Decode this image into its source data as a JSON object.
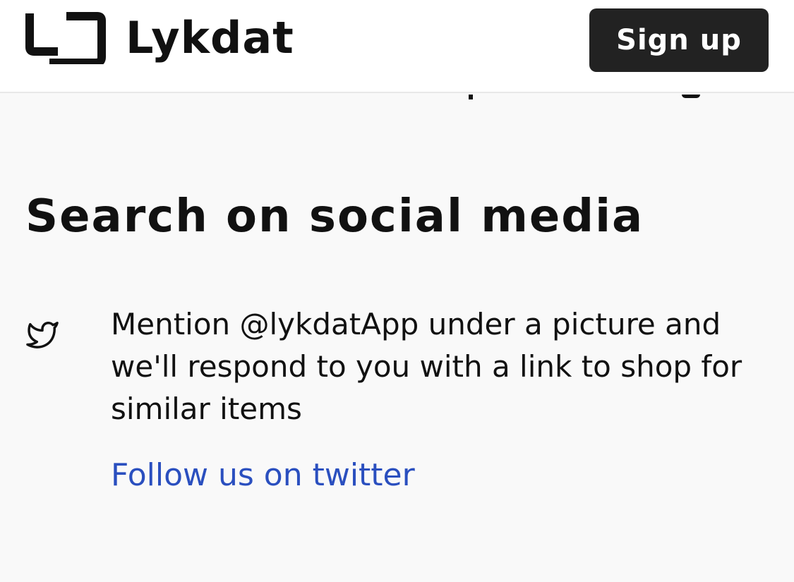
{
  "header": {
    "brand_name": "Lykdat",
    "logo_icon": "lykdat-logo-icon",
    "signup_label": "Sign up"
  },
  "social": {
    "title": "Search on social media",
    "twitter": {
      "icon": "twitter-bird-icon",
      "description": "Mention @lykdatApp under a picture and we'll respond to you with a link to shop for similar items",
      "link_label": "Follow us on twitter"
    }
  },
  "colors": {
    "background": "#f9f9f9",
    "header_background": "#ffffff",
    "button_background": "#222222",
    "link": "#2a4fbf",
    "text": "#111111"
  }
}
